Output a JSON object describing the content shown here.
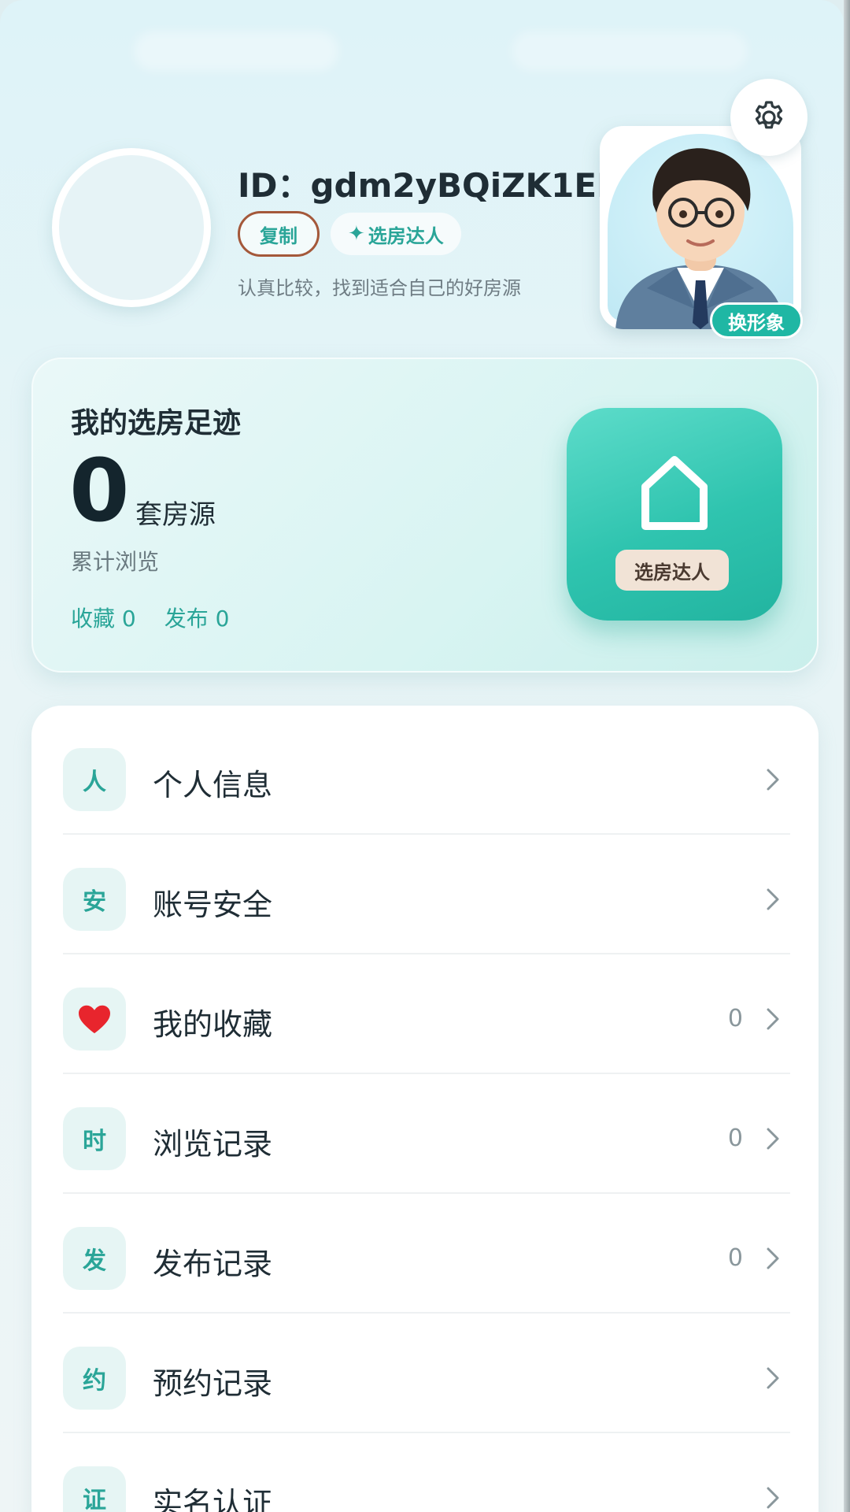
{
  "profile": {
    "id_text": "ID：gdm2yBQiZK1EEYs",
    "copy_label": "复制",
    "badge_label": "选房达人",
    "tagline": "认真比较，找到适合自己的好房源",
    "change_avatar_label": "换形象"
  },
  "footprint": {
    "title": "我的选房足迹",
    "count": "0",
    "unit": "套房源",
    "subtitle": "累计浏览",
    "favorites": "收藏 0",
    "published": "发布 0",
    "tile_label": "选房达人"
  },
  "menu": {
    "items": [
      {
        "icon": "人",
        "label": "个人信息",
        "count": ""
      },
      {
        "icon": "安",
        "label": "账号安全",
        "count": ""
      },
      {
        "icon": "heart",
        "label": "我的收藏",
        "count": "0"
      },
      {
        "icon": "时",
        "label": "浏览记录",
        "count": "0"
      },
      {
        "icon": "发",
        "label": "发布记录",
        "count": "0"
      },
      {
        "icon": "约",
        "label": "预约记录",
        "count": ""
      },
      {
        "icon": "证",
        "label": "实名认证",
        "count": ""
      }
    ]
  },
  "colors": {
    "accent": "#2aa598",
    "tile": "#2fc4af",
    "heart": "#e8252d"
  }
}
